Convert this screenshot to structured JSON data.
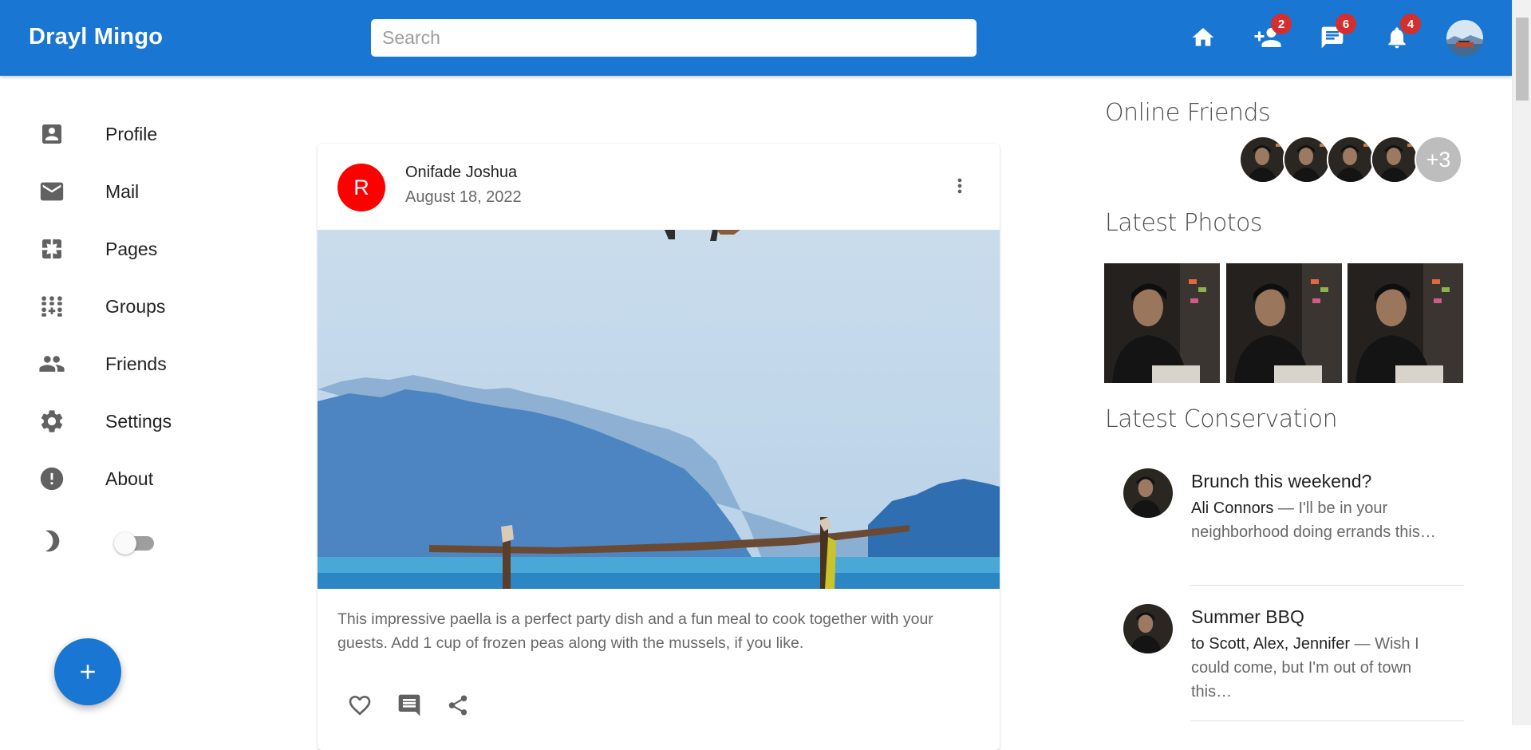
{
  "header": {
    "brand": "Drayl Mingo",
    "search_placeholder": "Search",
    "icons": [
      {
        "name": "home-icon"
      },
      {
        "name": "person-add-icon",
        "badge": "2"
      },
      {
        "name": "chat-icon",
        "badge": "6"
      },
      {
        "name": "notifications-icon",
        "badge": "4"
      }
    ],
    "badge_color": "#d32f2f",
    "bar_color": "#1976d2"
  },
  "sidebar": {
    "items": [
      {
        "label": "Profile",
        "icon": "account-box-icon"
      },
      {
        "label": "Mail",
        "icon": "mail-icon"
      },
      {
        "label": "Pages",
        "icon": "pages-icon"
      },
      {
        "label": "Groups",
        "icon": "groups-icon"
      },
      {
        "label": "Friends",
        "icon": "people-icon"
      },
      {
        "label": "Settings",
        "icon": "gear-icon"
      },
      {
        "label": "About",
        "icon": "error-icon"
      }
    ],
    "dark_mode_toggle": false
  },
  "fab": {
    "label": "+"
  },
  "post": {
    "avatar_letter": "R",
    "avatar_color": "#ff0000",
    "author": "Onifade Joshua",
    "date": "August 18, 2022",
    "text": "This impressive paella is a perfect party dish and a fun meal to cook together with your guests. Add 1 cup of frozen peas along with the mussels, if you like."
  },
  "rightbar": {
    "online_friends_title": "Online Friends",
    "online_more": "+3",
    "latest_photos_title": "Latest Photos",
    "latest_conversation_title": "Latest Conservation",
    "conversations": [
      {
        "title": "Brunch this weekend?",
        "from": "Ali Connors",
        "snippet": " — I'll be in your neighborhood doing errands this…"
      },
      {
        "title": "Summer BBQ",
        "from": "to Scott, Alex, Jennifer",
        "snippet": " — Wish I could come, but I'm out of town this…"
      }
    ]
  }
}
